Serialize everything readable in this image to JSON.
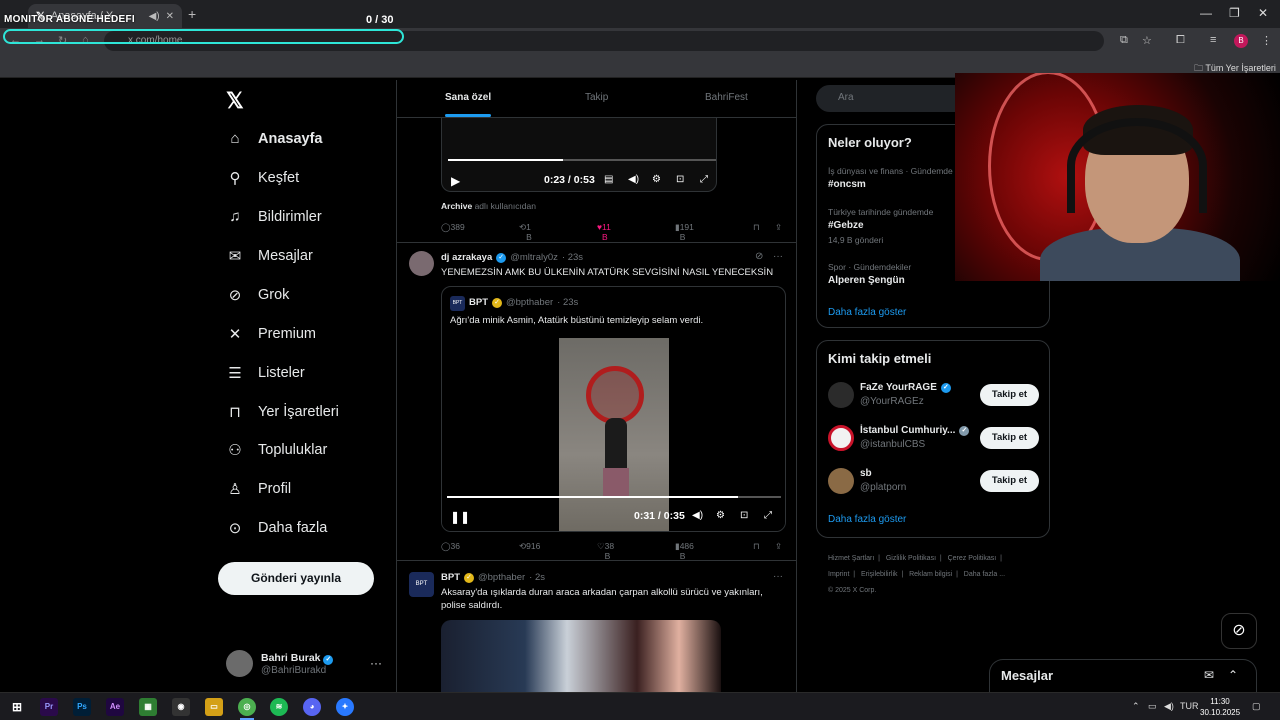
{
  "browser": {
    "tab_title": "Anasayfa / X",
    "new_tab": "+",
    "url": "x.com/home",
    "bookmarks_all": "Tüm Yer İşaretleri",
    "profile_initial": "B"
  },
  "overlay": {
    "title": "MONITOR ABONE HEDEFI",
    "count": "0  / 30"
  },
  "leftnav": {
    "items": [
      {
        "label": "Anasayfa",
        "icon": "home-icon"
      },
      {
        "label": "Keşfet",
        "icon": "search-icon"
      },
      {
        "label": "Bildirimler",
        "icon": "bell-icon"
      },
      {
        "label": "Mesajlar",
        "icon": "mail-icon"
      },
      {
        "label": "Grok",
        "icon": "grok-icon"
      },
      {
        "label": "Premium",
        "icon": "x-icon"
      },
      {
        "label": "Listeler",
        "icon": "list-icon"
      },
      {
        "label": "Yer İşaretleri",
        "icon": "bookmark-icon"
      },
      {
        "label": "Topluluklar",
        "icon": "people-icon"
      },
      {
        "label": "Profil",
        "icon": "person-icon"
      },
      {
        "label": "Daha fazla",
        "icon": "more-icon"
      }
    ],
    "post_button": "Gönderi yayınla",
    "me_name": "Bahri Burak",
    "me_handle": "@BahriBurakd",
    "more": "···"
  },
  "feed": {
    "tabs": [
      "Sana özel",
      "Takip",
      "BahriFest"
    ],
    "tweet1": {
      "video_time": "0:23 / 0:53",
      "video_progress": 0.43,
      "archive_bold": "Archive",
      "archive_rest": "adlı kullanıcıdan",
      "replies": "389",
      "reposts": "1 B",
      "likes": "11 B",
      "views": "191 B"
    },
    "tweet2": {
      "name": "dj azrakaya",
      "handle": "@mltraly0z",
      "time": "· 23s",
      "text": "YENEMEZSİN AMK BU ÜLKENİN ATATÜRK SEVGİSİNİ NASIL YENECEKSİN",
      "quote": {
        "avatar": "BPT",
        "name": "BPT",
        "handle": "@bpthaber",
        "time": "· 23s",
        "text": "Ağrı'da minik Asmin, Atatürk büstünü temizleyip selam verdi."
      },
      "video_time": "0:31 / 0:35",
      "video_progress": 0.87,
      "replies": "36",
      "reposts": "916",
      "likes": "38 B",
      "views": "486 B"
    },
    "tweet3": {
      "avatar": "BPT",
      "name": "BPT",
      "handle": "@bpthaber",
      "time": "· 2s",
      "text": "Aksaray'da ışıklarda duran araca arkadan çarpan alkollü sürücü ve yakınları, polise saldırdı."
    },
    "more": "···"
  },
  "sidebar": {
    "search_placeholder": "Ara",
    "trends_title": "Neler oluyor?",
    "trends": [
      {
        "meta": "İş dünyası ve finans · Gündemde",
        "name": "#oncsm",
        "count": ""
      },
      {
        "meta": "Türkiye tarihinde gündemde",
        "name": "#Gebze",
        "count": "14,9 B gönderi"
      },
      {
        "meta": "Spor · Gündemdekiler",
        "name": "Alperen Şengün",
        "count": ""
      }
    ],
    "trends_more": "Daha fazla göster",
    "wtf_title": "Kimi takip etmeli",
    "wtf": [
      {
        "name": "FaZe YourRAGE",
        "handle": "@YourRAGEz",
        "button": "Takip et"
      },
      {
        "name": "İstanbul Cumhuriy...",
        "handle": "@istanbulCBS",
        "button": "Takip et"
      },
      {
        "name": "sb",
        "handle": "@platporn",
        "button": "Takip et"
      }
    ],
    "wtf_more": "Daha fazla göster",
    "footer": [
      "Hizmet Şartları",
      "Gizlilik Politikası",
      "Çerez Politikası",
      "Imprint",
      "Erişilebilirlik",
      "Reklam bilgisi",
      "Daha fazla ...",
      "© 2025 X Corp."
    ]
  },
  "messages": {
    "title": "Mesajlar"
  },
  "taskbar": {
    "lang": "TUR",
    "time": "11:30",
    "date": "30.10.2025"
  },
  "colors": {
    "accent": "#1d9bf0",
    "like": "#f91880",
    "overlay_outline": "#2ee6d8"
  }
}
